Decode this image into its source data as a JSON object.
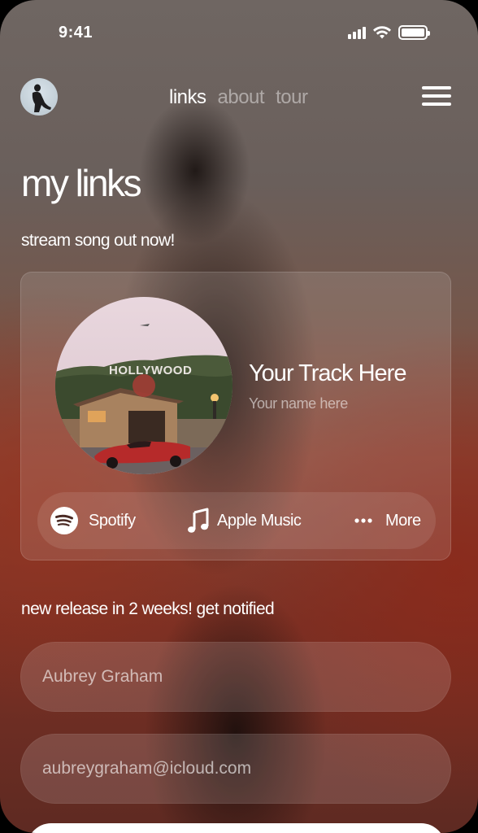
{
  "status_bar": {
    "time": "9:41"
  },
  "nav": {
    "tabs": [
      {
        "label": "links",
        "active": true
      },
      {
        "label": "about",
        "active": false
      },
      {
        "label": "tour",
        "active": false
      }
    ]
  },
  "page_title": "my links",
  "stream_section": {
    "label": "stream song out now!",
    "track_title": "Your Track Here",
    "track_artist": "Your name here",
    "artwork_sign_text": "HOLLYWOOD",
    "services": [
      {
        "label": "Spotify",
        "icon": "spotify-icon"
      },
      {
        "label": "Apple Music",
        "icon": "music-note-icon"
      },
      {
        "label": "More",
        "icon": "more-dots-icon"
      }
    ]
  },
  "notify_section": {
    "label": "new release in 2 weeks! get notified",
    "name_value": "Aubrey Graham",
    "email_value": "aubreygraham@icloud.com"
  },
  "colors": {
    "accent_white": "#ffffff",
    "muted_text": "rgba(255,255,255,0.55)",
    "background_top": "#6f6662",
    "background_bottom": "#7a3024"
  }
}
